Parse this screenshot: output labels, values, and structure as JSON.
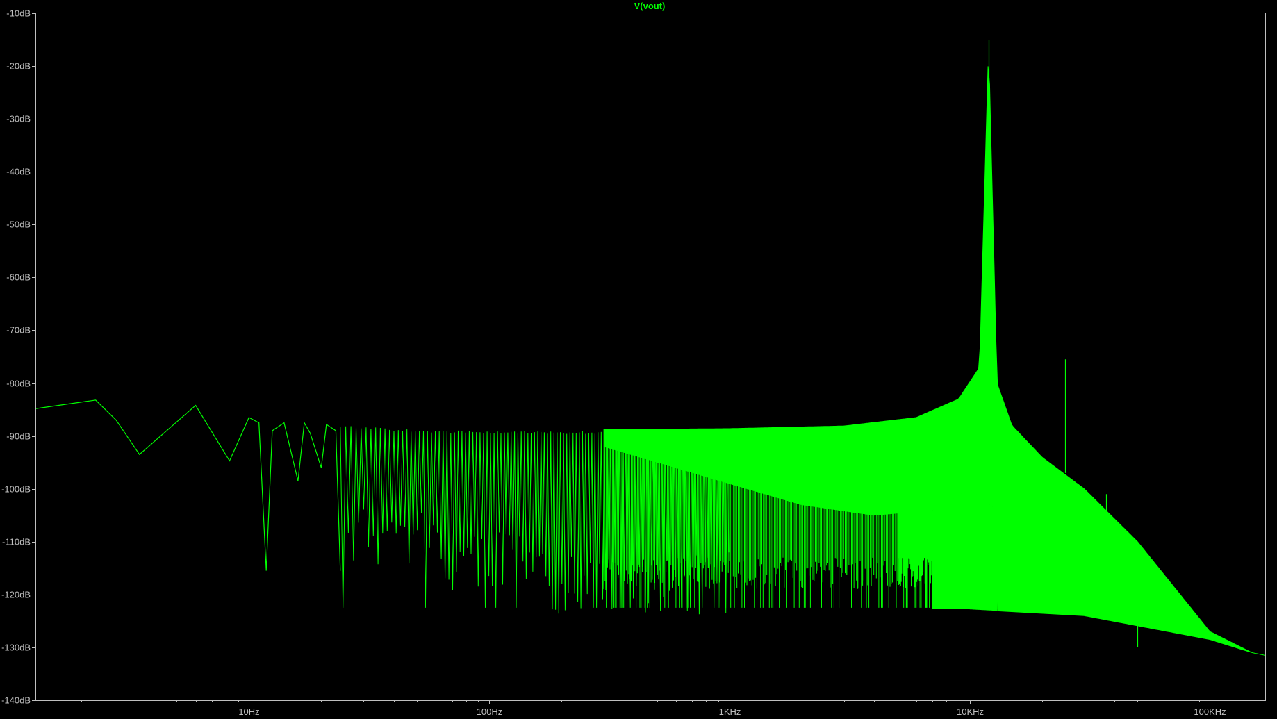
{
  "window": {
    "title": "V(vout)"
  },
  "chart_data": {
    "type": "line",
    "title": "V(vout)",
    "xlabel": "",
    "ylabel": "",
    "x_scale": "log",
    "xlim": [
      1.3,
      170000
    ],
    "ylim": [
      -140,
      -10
    ],
    "x_ticks": [
      {
        "value": 10,
        "label": "10Hz"
      },
      {
        "value": 100,
        "label": "100Hz"
      },
      {
        "value": 1000,
        "label": "1KHz"
      },
      {
        "value": 10000,
        "label": "10KHz"
      },
      {
        "value": 100000,
        "label": "100KHz"
      }
    ],
    "y_ticks": [
      {
        "value": -10,
        "label": "-10dB"
      },
      {
        "value": -20,
        "label": "-20dB"
      },
      {
        "value": -30,
        "label": "-30dB"
      },
      {
        "value": -40,
        "label": "-40dB"
      },
      {
        "value": -50,
        "label": "-50dB"
      },
      {
        "value": -60,
        "label": "-60dB"
      },
      {
        "value": -70,
        "label": "-70dB"
      },
      {
        "value": -80,
        "label": "-80dB"
      },
      {
        "value": -90,
        "label": "-90dB"
      },
      {
        "value": -100,
        "label": "-100dB"
      },
      {
        "value": -110,
        "label": "-110dB"
      },
      {
        "value": -120,
        "label": "-120dB"
      },
      {
        "value": -130,
        "label": "-130dB"
      },
      {
        "value": -140,
        "label": "-140dB"
      }
    ],
    "grid": false,
    "legend": "top-center",
    "series": [
      {
        "name": "V(vout)",
        "color": "#00ff00",
        "upper_envelope": {
          "x": [
            1.3,
            2.3,
            6,
            10,
            20,
            50,
            100,
            300,
            1000,
            3000,
            6000,
            9000,
            11000,
            12000,
            13000,
            15000,
            20000,
            30000,
            50000,
            100000,
            150000,
            170000
          ],
          "y": [
            -84.8,
            -83.2,
            -84.2,
            -86.5,
            -87.5,
            -88.5,
            -88.8,
            -88.8,
            -88.6,
            -88.1,
            -86.5,
            -83,
            -77,
            -16,
            -80,
            -88,
            -94,
            -100,
            -110,
            -127,
            -131,
            -131.5
          ]
        },
        "lower_envelope": {
          "x": [
            300,
            1000,
            3000,
            10000,
            30000,
            100000,
            150000,
            170000
          ],
          "y": [
            -122.7,
            -122.7,
            -122.6,
            -122.8,
            -124,
            -128.5,
            -131,
            -131.5
          ]
        },
        "low_freq_trace": {
          "x": [
            1.3,
            2.3,
            2.8,
            3.5,
            6,
            8.3,
            10,
            11,
            11.8,
            12.5,
            14,
            16,
            17,
            18,
            20,
            21,
            23,
            24
          ],
          "y": [
            -84.8,
            -83.2,
            -87,
            -93.5,
            -84.2,
            -94.7,
            -86.5,
            -87.5,
            -115.5,
            -89,
            -87.5,
            -98.5,
            -87.5,
            -89.5,
            -96,
            -87.8,
            -89,
            -115.5
          ]
        },
        "spikes": [
          {
            "x": 12000,
            "y_from": -98,
            "y_to": -15
          },
          {
            "x": 25000,
            "y_from": -97,
            "y_to": -75.5
          },
          {
            "x": 37000,
            "y_from": -107,
            "y_to": -101
          },
          {
            "x": 50000,
            "y_from": -130,
            "y_to": -125
          }
        ]
      }
    ]
  }
}
